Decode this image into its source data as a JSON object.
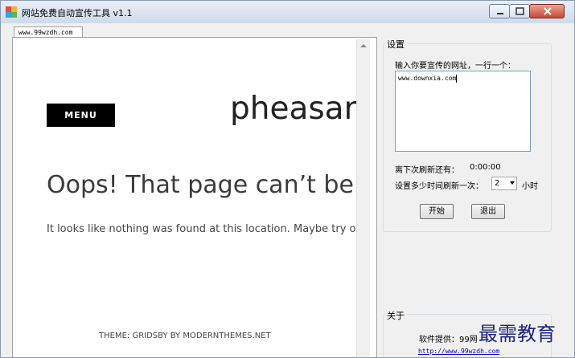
{
  "window": {
    "title": "网站免费自动宣传工具 v1.1"
  },
  "tab": {
    "label": "www.99wzdh.com"
  },
  "browser": {
    "menu_label": "MENU",
    "site_name": "pheasar",
    "heading": "Oops! That page can’t be",
    "message": "It looks like nothing was found at this location. Maybe try or",
    "footer": "THEME: GRIDSBY BY MODERNTHEMES.NET"
  },
  "settings": {
    "title": "设置",
    "url_label": "输入你要宣传的网址，一行一个：",
    "url_value": "www.downxia.com",
    "countdown_label": "离下次刷新还有：",
    "countdown_value": "0:00:00",
    "interval_label": "设置多少时间刷新一次：",
    "interval_value": "2",
    "interval_unit": "小时",
    "start_button": "开始",
    "exit_button": "退出"
  },
  "about": {
    "title": "关于",
    "provider": "软件提供：99网",
    "link": "http://www.99wzdh.com"
  },
  "watermark": "最需教育"
}
